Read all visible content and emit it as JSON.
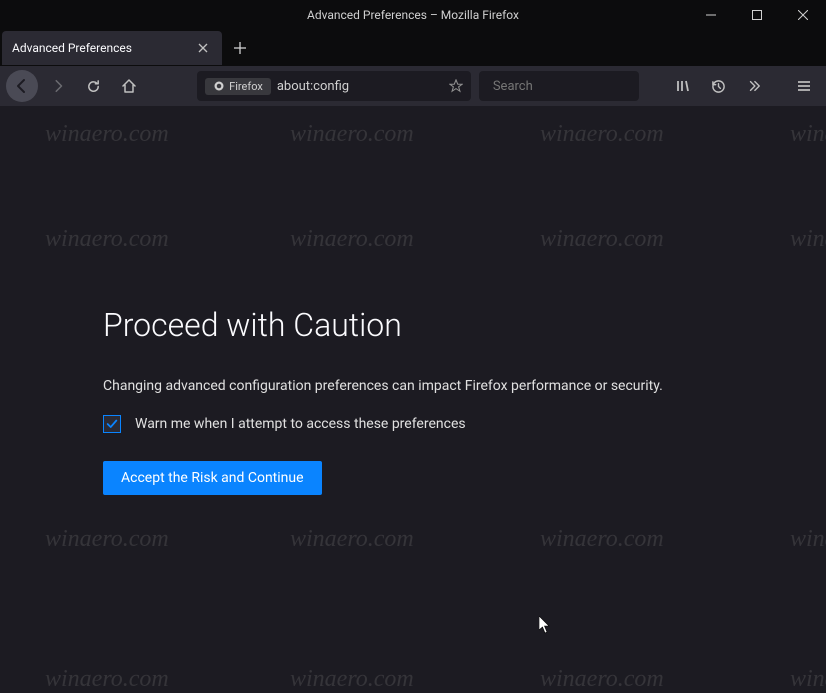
{
  "window": {
    "title": "Advanced Preferences – Mozilla Firefox"
  },
  "tab": {
    "label": "Advanced Preferences"
  },
  "urlbar": {
    "identity_label": "Firefox",
    "url": "about:config"
  },
  "searchbar": {
    "placeholder": "Search"
  },
  "warning": {
    "title": "Proceed with Caution",
    "message": "Changing advanced configuration preferences can impact Firefox performance or security.",
    "checkbox_label": "Warn me when I attempt to access these preferences",
    "checkbox_checked": true,
    "accept_button": "Accept the Risk and Continue"
  },
  "watermark_text": "winaero.com"
}
